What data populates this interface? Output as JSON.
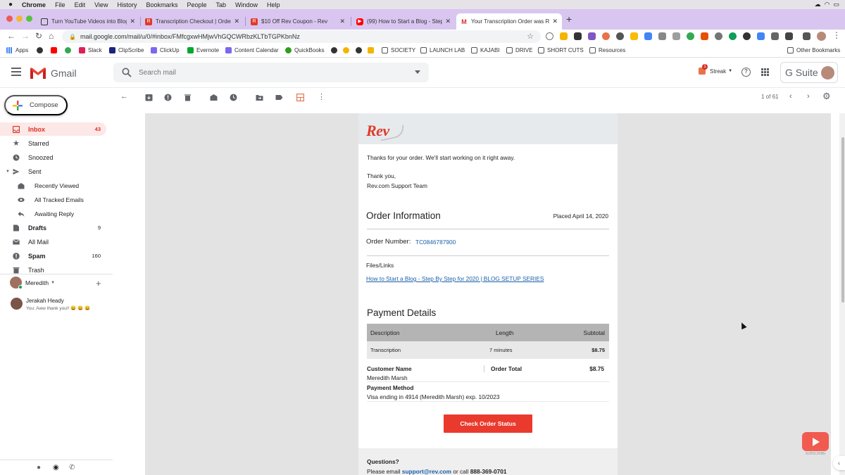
{
  "macos": {
    "menu": [
      "Chrome",
      "File",
      "Edit",
      "View",
      "History",
      "Bookmarks",
      "People",
      "Tab",
      "Window",
      "Help"
    ]
  },
  "browser": {
    "tabs": [
      {
        "title": "Turn YouTube Videos into Blog P",
        "color": "#333333"
      },
      {
        "title": "Transcription Checkout | Order F",
        "color": "#e03a2a"
      },
      {
        "title": "$10 Off Rev Coupon - Rev",
        "color": "#e03a2a"
      },
      {
        "title": "(99) How to Start a Blog - Step",
        "color": "#ff0000"
      },
      {
        "title": "Your Transcription Order was Re",
        "color": "#d93025",
        "active": true
      }
    ],
    "url": "mail.google.com/mail/u/0/#inbox/FMfcgxwHMjwVhGQCWRbzKLTbTGPKbnNz",
    "bookmarks": [
      "Apps",
      "Slack",
      "ClipScribe",
      "ClickUp",
      "Evernote",
      "Content Calendar",
      "QuickBooks",
      "SOCIETY",
      "LAUNCH LAB",
      "KAJABI",
      "DRIVE",
      "SHORT CUTS",
      "Resources",
      "Other Bookmarks"
    ]
  },
  "gmail": {
    "product_name": "Gmail",
    "search_placeholder": "Search mail",
    "streak_label": "Streak",
    "streak_badge": "1",
    "gsuite_label": "G Suite",
    "compose_label": "Compose",
    "pager": "1 of 61",
    "nav": [
      {
        "label": "Inbox",
        "count": "43"
      },
      {
        "label": "Starred",
        "count": ""
      },
      {
        "label": "Snoozed",
        "count": ""
      },
      {
        "label": "Sent",
        "count": ""
      },
      {
        "label": "Recently Viewed",
        "count": ""
      },
      {
        "label": "All Tracked Emails",
        "count": ""
      },
      {
        "label": "Awaiting Reply",
        "count": ""
      },
      {
        "label": "Drafts",
        "count": "9"
      },
      {
        "label": "All Mail",
        "count": ""
      },
      {
        "label": "Spam",
        "count": "160"
      },
      {
        "label": "Trash",
        "count": ""
      }
    ],
    "hangouts_user": "Meredith",
    "contact_name": "Jerakah Heady",
    "contact_message": "You: Aww thank you!! 😀 😀 😀"
  },
  "email": {
    "logo": "Rev",
    "thanks_line": "Thanks for your order. We'll start working on it right away.",
    "signoff": "Thank you,",
    "team": "Rev.com Support Team",
    "order_heading": "Order Information",
    "placed": "Placed April 14, 2020",
    "order_number_label": "Order Number:",
    "order_number": "TC0846787900",
    "files_label": "Files/Links",
    "file_link": "How to Start a Blog - Step By Step for 2020 | BLOG SETUP SERIES",
    "payment_heading": "Payment Details",
    "table_headers": [
      "Description",
      "Length",
      "Subtotal"
    ],
    "table_row": [
      "Transcription",
      "7 minutes",
      "$8.75"
    ],
    "customer_name_label": "Customer Name",
    "customer_name": "Meredith Marsh",
    "order_total_label": "Order Total",
    "order_total": "$8.75",
    "payment_method_label": "Payment Method",
    "payment_method": "Visa ending in 4914 (Meredith Marsh) exp. 10/2023",
    "cta": "Check Order Status",
    "questions": "Questions?",
    "contact_prefix": "Please email",
    "support_email": "support@rev.com",
    "contact_mid": "or call",
    "phone": "888-369-0701"
  },
  "overlay": {
    "subscribe_label": "SUBSCRIBE"
  }
}
